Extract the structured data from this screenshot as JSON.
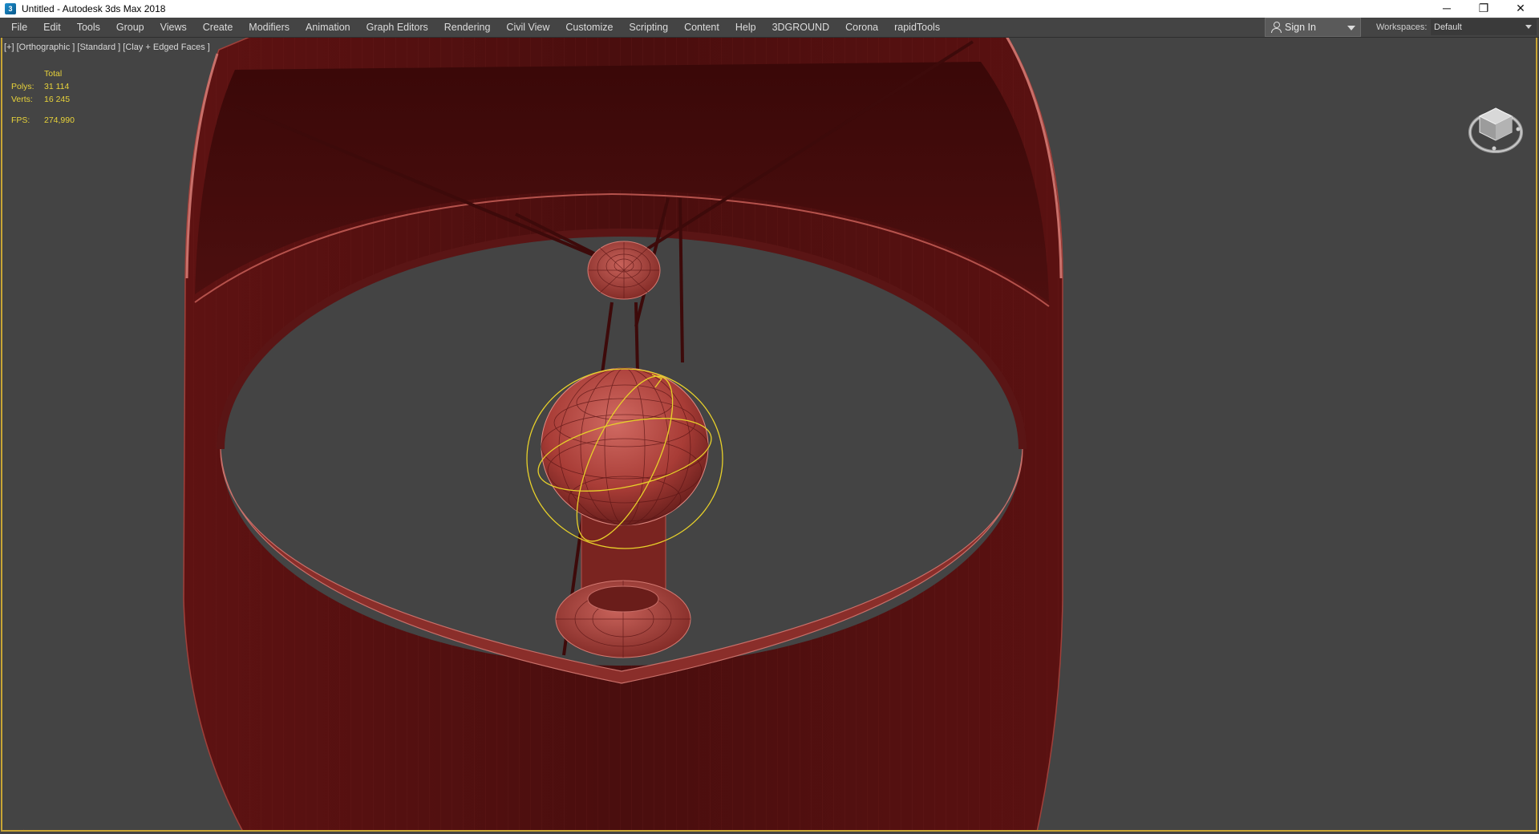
{
  "window": {
    "title": "Untitled - Autodesk 3ds Max 2018",
    "icon": "3ds-max-app-icon",
    "controls": {
      "minimize": "─",
      "restore": "❐",
      "close": "✕"
    }
  },
  "menu": [
    "File",
    "Edit",
    "Tools",
    "Group",
    "Views",
    "Create",
    "Modifiers",
    "Animation",
    "Graph Editors",
    "Rendering",
    "Civil View",
    "Customize",
    "Scripting",
    "Content",
    "Help",
    "3DGROUND",
    "Corona",
    "rapidTools"
  ],
  "account": {
    "sign_in_label": "Sign In",
    "icon": "user-icon"
  },
  "workspaces": {
    "label": "Workspaces:",
    "value": "Default"
  },
  "viewport": {
    "label": "[+] [Orthographic ] [Standard ] [Clay + Edged Faces ]",
    "stats": {
      "header": "Total",
      "polys_label": "Polys:",
      "polys_value": "31 114",
      "verts_label": "Verts:",
      "verts_value": "16 245",
      "fps_label": "FPS:",
      "fps_value": "274,990"
    },
    "colors": {
      "background": "#444444",
      "clay_dark": "#3d0a0a",
      "clay_mid": "#6b1a1a",
      "clay_light": "#c0504a",
      "edge": "#c9706a",
      "selection": "#e8d12a",
      "active_border": "#c8a534"
    }
  }
}
